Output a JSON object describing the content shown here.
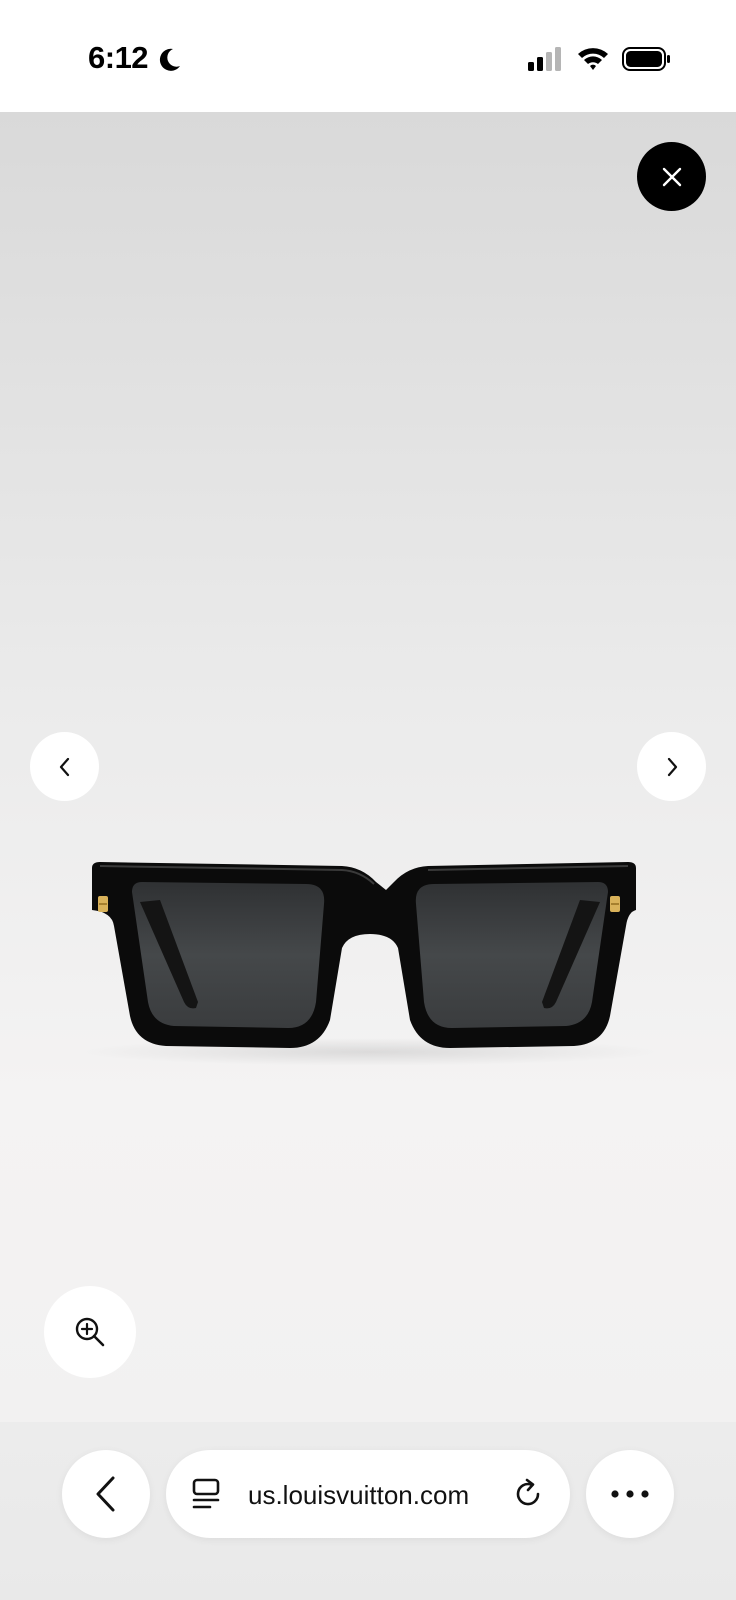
{
  "status_bar": {
    "time": "6:12",
    "icons": [
      "moon-icon",
      "signal-icon",
      "wifi-icon",
      "battery-icon"
    ]
  },
  "viewer": {
    "image": "sunglasses-product-image",
    "controls": [
      "close-icon",
      "chevron-left-icon",
      "chevron-right-icon",
      "zoom-in-icon"
    ],
    "colors": {
      "close_button_bg": "#000000",
      "control_bg": "#ffffff",
      "frame": "#0a0a0a",
      "lens": "#3b3d3f",
      "hinge_accent": "#d9b25a"
    }
  },
  "browser": {
    "url": "us.louisvuitton.com",
    "icons": [
      "back-arrow-icon",
      "reader-icon",
      "reload-icon",
      "more-icon"
    ]
  }
}
